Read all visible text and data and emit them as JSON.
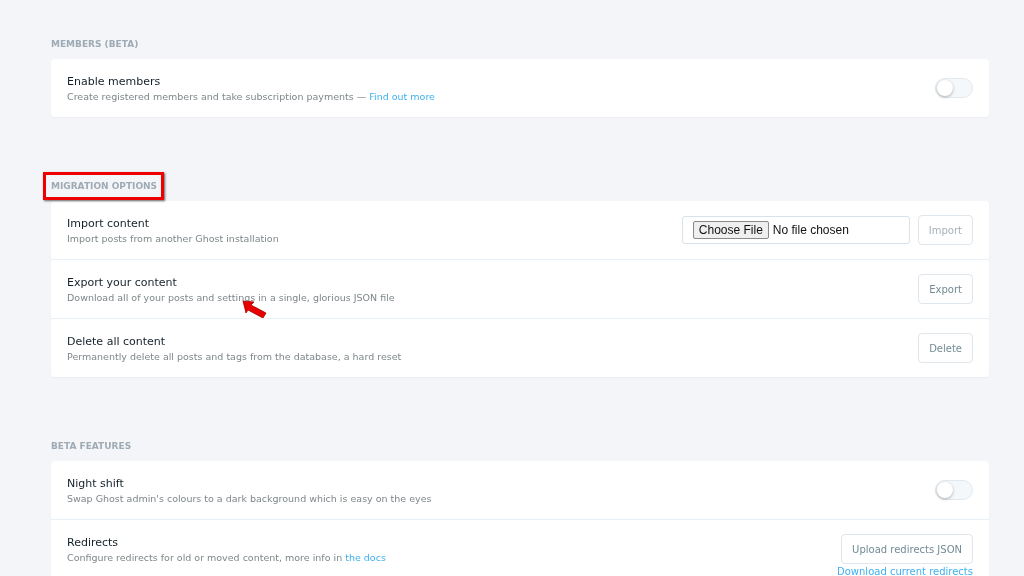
{
  "sections": [
    {
      "title": "MEMBERS (BETA)",
      "highlighted": false,
      "rows": [
        {
          "kind": "toggle",
          "title": "Enable members",
          "description": "Create registered members and take subscription payments — ",
          "link": "Find out more",
          "on": false
        }
      ]
    },
    {
      "title": "MIGRATION OPTIONS",
      "highlighted": true,
      "rows": [
        {
          "kind": "file",
          "title": "Import content",
          "description": "Import posts from another Ghost installation",
          "file_button": "Choose File",
          "file_status": "No file chosen",
          "button": "Import",
          "disabled": true
        },
        {
          "kind": "button",
          "title": "Export your content",
          "description": "Download all of your posts and settings in a single, glorious JSON file",
          "button": "Export",
          "disabled": false,
          "pointer": true
        },
        {
          "kind": "button",
          "title": "Delete all content",
          "description": "Permanently delete all posts and tags from the database, a hard reset",
          "button": "Delete",
          "disabled": false,
          "pointer": false
        }
      ]
    },
    {
      "title": "BETA FEATURES",
      "highlighted": false,
      "rows": [
        {
          "kind": "toggle",
          "title": "Night shift",
          "description": "Swap Ghost admin's colours to a dark background which is easy on the eyes",
          "on": false
        },
        {
          "kind": "redirects",
          "title": "Redirects",
          "description": "Configure redirects for old or moved content, more info in ",
          "link": "the docs",
          "button": "Upload redirects JSON",
          "secondary_link": "Download current redirects"
        }
      ]
    }
  ]
}
